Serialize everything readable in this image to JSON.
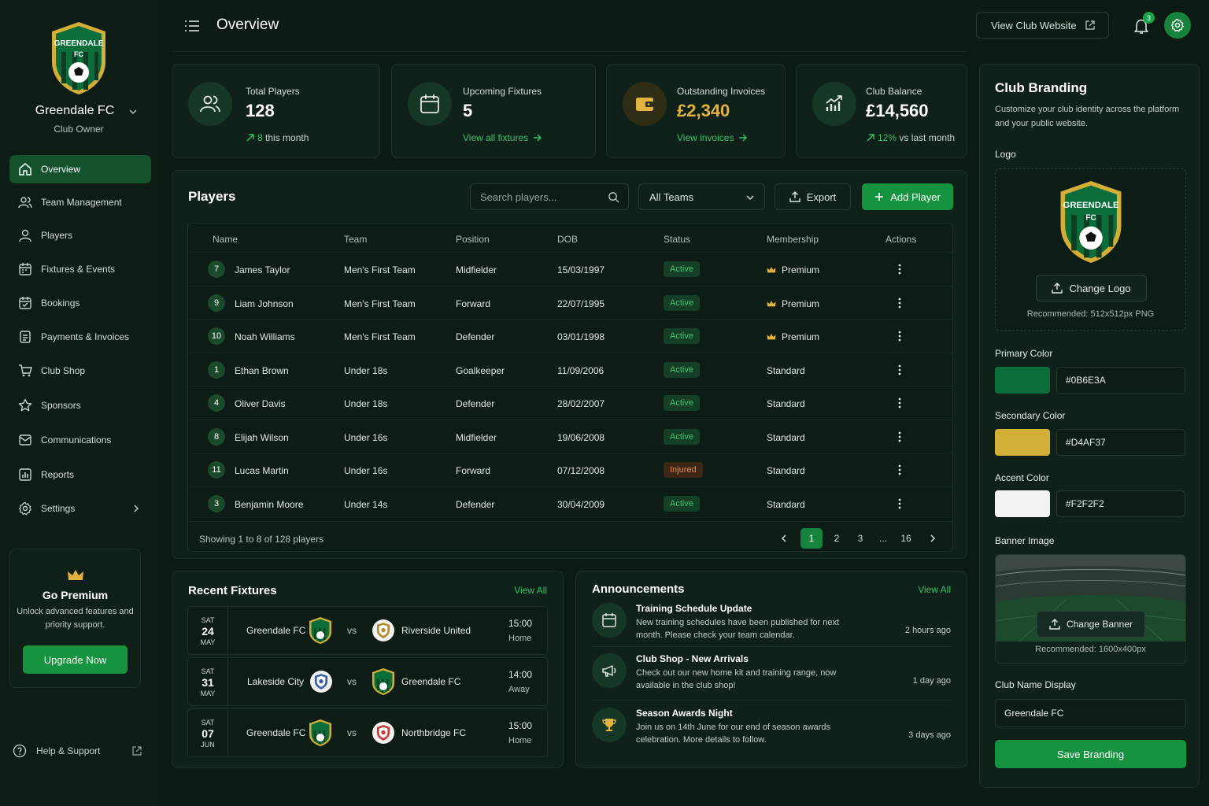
{
  "colors": {
    "accent": "#16933f",
    "primary": "#0B6E3A",
    "secondary": "#D4AF37",
    "tertiary": "#F2F2F2",
    "injured": "#ec8a3d"
  },
  "club": {
    "name": "Greendale FC",
    "role": "Club Owner",
    "crest_text": "GREENDALE",
    "crest_sub": "FC"
  },
  "nav": [
    {
      "label": "Overview",
      "icon": "home-icon"
    },
    {
      "label": "Team Management",
      "icon": "team-icon"
    },
    {
      "label": "Players",
      "icon": "user-icon"
    },
    {
      "label": "Fixtures & Events",
      "icon": "calendar-icon"
    },
    {
      "label": "Bookings",
      "icon": "booking-icon"
    },
    {
      "label": "Payments & Invoices",
      "icon": "invoice-icon"
    },
    {
      "label": "Club Shop",
      "icon": "cart-icon"
    },
    {
      "label": "Sponsors",
      "icon": "star-icon"
    },
    {
      "label": "Communications",
      "icon": "mail-icon"
    },
    {
      "label": "Reports",
      "icon": "chart-icon"
    },
    {
      "label": "Settings",
      "icon": "gear-icon"
    }
  ],
  "premium": {
    "title": "Go Premium",
    "desc": "Unlock advanced features and priority support.",
    "button": "Upgrade Now"
  },
  "help": "Help & Support",
  "topbar": {
    "title": "Overview",
    "website_button": "View Club Website",
    "notifications": "3"
  },
  "stats": [
    {
      "label": "Total Players",
      "value": "128",
      "sub_value": "8",
      "sub_text": "this month"
    },
    {
      "label": "Upcoming Fixtures",
      "value": "5",
      "link": "View all fixtures"
    },
    {
      "label": "Outstanding Invoices",
      "value": "£2,340",
      "link": "View invoices"
    },
    {
      "label": "Club Balance",
      "value": "£14,560",
      "sub_value": "12%",
      "sub_text": "vs last month"
    }
  ],
  "players": {
    "title": "Players",
    "search_placeholder": "Search players...",
    "team_filter": "All Teams",
    "export": "Export",
    "add": "Add Player",
    "columns": [
      "Name",
      "Team",
      "Position",
      "DOB",
      "Status",
      "Membership",
      "Actions"
    ],
    "rows": [
      {
        "num": "7",
        "name": "James Taylor",
        "team": "Men's First Team",
        "position": "Midfielder",
        "dob": "15/03/1997",
        "status": "Active",
        "membership": "Premium"
      },
      {
        "num": "9",
        "name": "Liam Johnson",
        "team": "Men's First Team",
        "position": "Forward",
        "dob": "22/07/1995",
        "status": "Active",
        "membership": "Premium"
      },
      {
        "num": "10",
        "name": "Noah Williams",
        "team": "Men's First Team",
        "position": "Defender",
        "dob": "03/01/1998",
        "status": "Active",
        "membership": "Premium"
      },
      {
        "num": "1",
        "name": "Ethan Brown",
        "team": "Under 18s",
        "position": "Goalkeeper",
        "dob": "11/09/2006",
        "status": "Active",
        "membership": "Standard"
      },
      {
        "num": "4",
        "name": "Oliver Davis",
        "team": "Under 18s",
        "position": "Defender",
        "dob": "28/02/2007",
        "status": "Active",
        "membership": "Standard"
      },
      {
        "num": "8",
        "name": "Elijah Wilson",
        "team": "Under 16s",
        "position": "Midfielder",
        "dob": "19/06/2008",
        "status": "Active",
        "membership": "Standard"
      },
      {
        "num": "11",
        "name": "Lucas Martin",
        "team": "Under 16s",
        "position": "Forward",
        "dob": "07/12/2008",
        "status": "Injured",
        "membership": "Standard"
      },
      {
        "num": "3",
        "name": "Benjamin Moore",
        "team": "Under 14s",
        "position": "Defender",
        "dob": "30/04/2009",
        "status": "Active",
        "membership": "Standard"
      }
    ],
    "showing": "Showing 1 to 8 of 128 players",
    "pages": [
      "1",
      "2",
      "3",
      "...",
      "16"
    ]
  },
  "fixtures": {
    "title": "Recent Fixtures",
    "view_all": "View All",
    "items": [
      {
        "day": "SAT",
        "date": "24",
        "month": "MAY",
        "home": "Greendale FC",
        "away": "Riverside United",
        "time": "15:00",
        "venue": "Home"
      },
      {
        "day": "SAT",
        "date": "31",
        "month": "MAY",
        "home": "Lakeside City",
        "away": "Greendale FC",
        "time": "14:00",
        "venue": "Away"
      },
      {
        "day": "SAT",
        "date": "07",
        "month": "JUN",
        "home": "Greendale FC",
        "away": "Northbridge FC",
        "time": "15:00",
        "venue": "Home"
      }
    ],
    "vs": "vs"
  },
  "announcements": {
    "title": "Announcements",
    "view_all": "View All",
    "items": [
      {
        "title": "Training Schedule Update",
        "body": "New training schedules have been published for next month. Please check your team calendar.",
        "time": "2 hours ago"
      },
      {
        "title": "Club Shop - New Arrivals",
        "body": "Check out our new home kit and training range, now available in the club shop!",
        "time": "1 day ago"
      },
      {
        "title": "Season Awards Night",
        "body": "Join us on 14th June for our end of season awards celebration. More details to follow.",
        "time": "3 days ago"
      }
    ]
  },
  "branding": {
    "title": "Club Branding",
    "desc": "Customize your club identity across the platform and your public website.",
    "logo_label": "Logo",
    "change_logo": "Change Logo",
    "logo_rec": "Recommended: 512x512px PNG",
    "primary_label": "Primary Color",
    "primary_value": "#0B6E3A",
    "secondary_label": "Secondary Color",
    "secondary_value": "#D4AF37",
    "accent_label": "Accent Color",
    "accent_value": "#F2F2F2",
    "banner_label": "Banner Image",
    "change_banner": "Change Banner",
    "banner_rec": "Recommended: 1600x400px",
    "name_label": "Club Name Display",
    "name_value": "Greendale FC",
    "save": "Save Branding"
  }
}
